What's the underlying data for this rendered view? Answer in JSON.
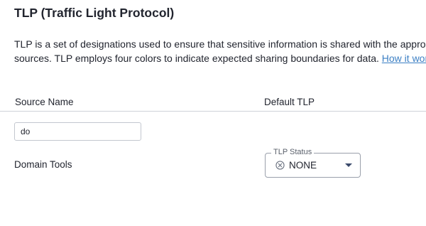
{
  "section": {
    "title": "TLP (Traffic Light Protocol)",
    "description_line1": "TLP is a set of designations used to ensure that sensitive information is shared with the appropriate",
    "description_line2": "sources. TLP employs four colors to indicate expected sharing boundaries for data.",
    "help_link": "How it works"
  },
  "table": {
    "columns": [
      "Source Name",
      "Default TLP"
    ],
    "filter": {
      "value": "do",
      "placeholder": ""
    },
    "rows": [
      {
        "source_name": "Domain Tools",
        "tlp": {
          "label": "TLP Status",
          "value": "NONE",
          "icon": "circle-x-icon"
        }
      }
    ]
  },
  "colors": {
    "link": "#3b7fc4",
    "text": "#22252f",
    "border": "#9aa0ab",
    "caret": "#3b4a6b"
  }
}
